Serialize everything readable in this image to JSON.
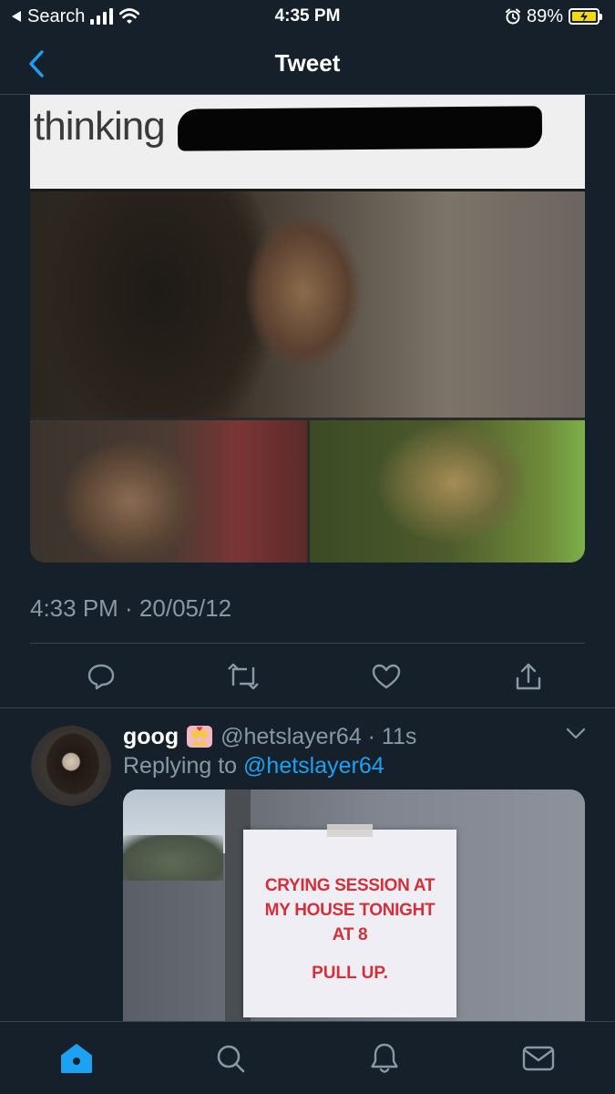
{
  "status_bar": {
    "back_app": "Search",
    "time": "4:35 PM",
    "battery_percent": "89%",
    "battery_level": 0.89,
    "icons": [
      "back-triangle-icon",
      "signal-icon",
      "wifi-icon",
      "alarm-icon",
      "battery-charging-icon"
    ]
  },
  "nav": {
    "title": "Tweet",
    "back_icon": "chevron-left-icon"
  },
  "tweet": {
    "meme_word": "thinking",
    "timestamp": "4:33 PM · 20/05/12",
    "actions": [
      "reply-icon",
      "retweet-icon",
      "like-icon",
      "share-icon"
    ]
  },
  "reply": {
    "name": "goog",
    "emoji": "💏",
    "handle_time": "@hetslayer64 · 11s",
    "replying_prefix": "Replying to ",
    "replying_mention": "@hetslayer64",
    "sign_lines": [
      "CRYING SESSION AT",
      "MY HOUSE TONIGHT",
      "AT 8"
    ],
    "sign_pull": "PULL UP."
  },
  "tab_bar": {
    "items": [
      "home-icon",
      "search-icon",
      "notifications-icon",
      "messages-icon"
    ],
    "active": "home-icon"
  },
  "colors": {
    "background": "#15202b",
    "divider": "#38444d",
    "secondary_text": "#8899a6",
    "accent": "#1da1f2",
    "battery": "#f5d90a",
    "sign_text": "#d2303a"
  }
}
